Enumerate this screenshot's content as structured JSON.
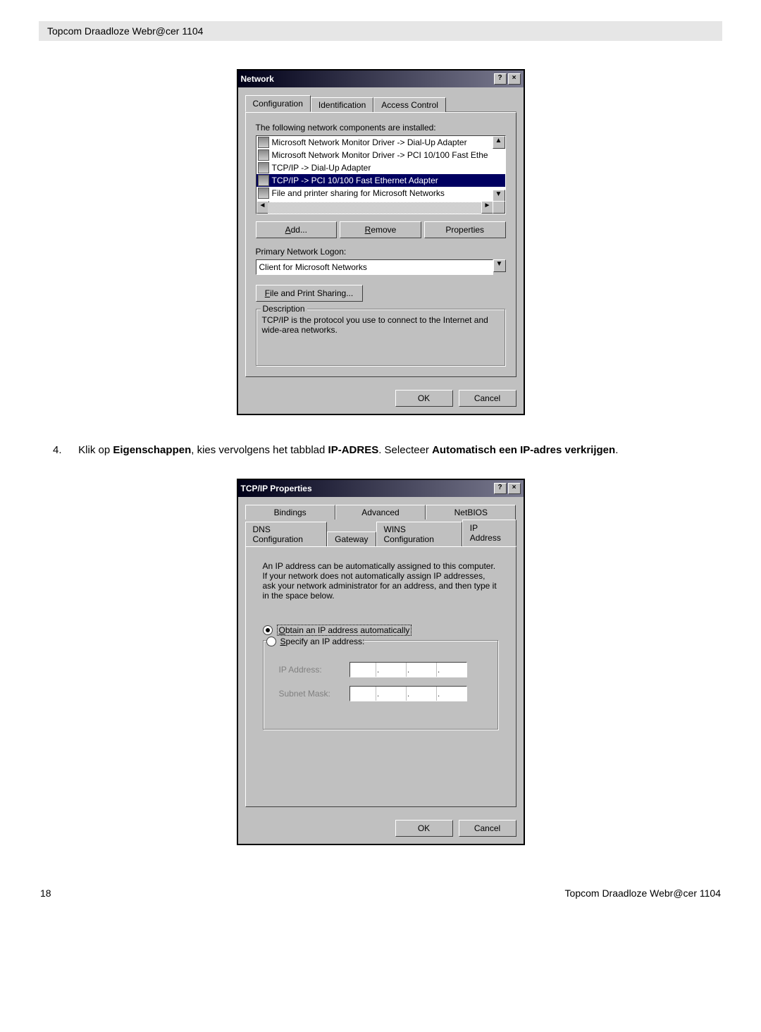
{
  "header": {
    "title": "Topcom Draadloze Webr@cer 1104"
  },
  "dialog1": {
    "title": "Network",
    "tabs": [
      "Configuration",
      "Identification",
      "Access Control"
    ],
    "activeTab": 0,
    "componentsLabel": "The following network components are installed:",
    "components": [
      {
        "text": "Microsoft Network Monitor Driver -> Dial-Up Adapter",
        "selected": false
      },
      {
        "text": "Microsoft Network Monitor Driver -> PCI 10/100 Fast Ethe",
        "selected": false
      },
      {
        "text": "TCP/IP -> Dial-Up Adapter",
        "selected": false
      },
      {
        "text": "TCP/IP -> PCI 10/100 Fast Ethernet Adapter",
        "selected": true
      },
      {
        "text": "File and printer sharing for Microsoft Networks",
        "selected": false
      }
    ],
    "buttons": {
      "add": "Add...",
      "remove": "Remove",
      "properties": "Properties"
    },
    "primaryLogonLabel": "Primary Network Logon:",
    "primaryLogonValue": "Client for Microsoft Networks",
    "fileShareBtn": "File and Print Sharing...",
    "descLegend": "Description",
    "descText": "TCP/IP is the protocol you use to connect to the Internet and wide-area networks.",
    "ok": "OK",
    "cancel": "Cancel"
  },
  "instruction": {
    "number": "4.",
    "pre": "Klik op ",
    "b1": "Eigenschappen",
    "mid1": ", kies vervolgens het tabblad ",
    "b2": "IP-ADRES",
    "mid2": ". Selecteer ",
    "b3": "Automatisch een IP-adres verkrijgen",
    "end": "."
  },
  "dialog2": {
    "title": "TCP/IP Properties",
    "tabsRow1": [
      "Bindings",
      "Advanced",
      "NetBIOS"
    ],
    "tabsRow2": [
      "DNS Configuration",
      "Gateway",
      "WINS Configuration",
      "IP Address"
    ],
    "activeTab": "IP Address",
    "infoText": "An IP address can be automatically assigned to this computer. If your network does not automatically assign IP addresses, ask your network administrator for an address, and then type it in the space below.",
    "radioAuto": "Obtain an IP address automatically",
    "radioSpecify": "Specify an IP address:",
    "ipLabel": "IP Address:",
    "subnetLabel": "Subnet Mask:",
    "ok": "OK",
    "cancel": "Cancel"
  },
  "footer": {
    "pageNum": "18",
    "product": "Topcom Draadloze Webr@cer 1104"
  }
}
